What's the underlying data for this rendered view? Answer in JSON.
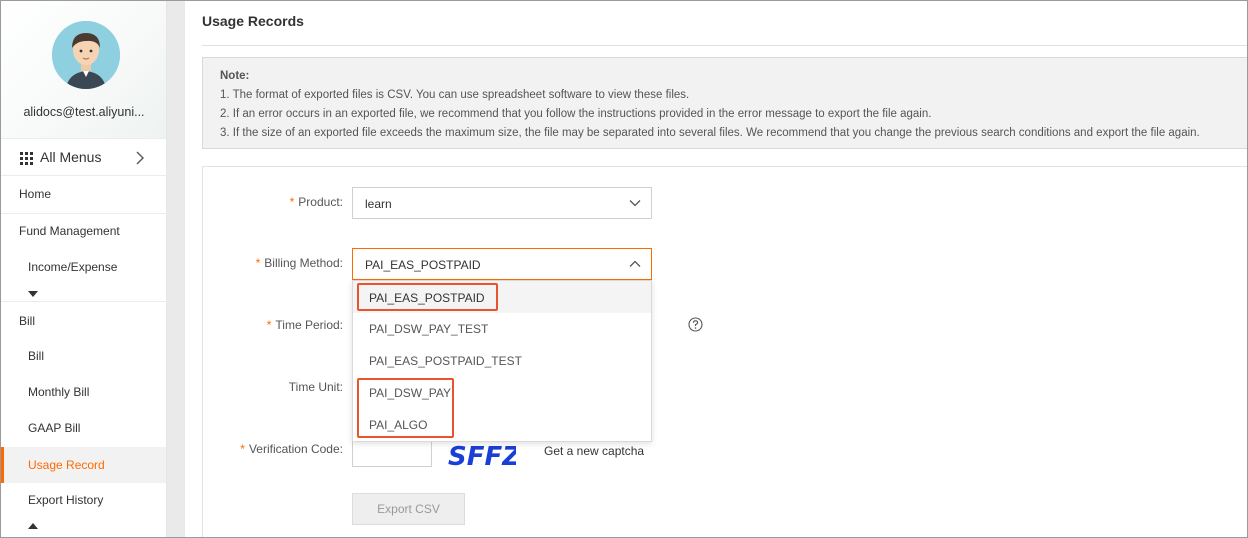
{
  "user": {
    "email": "alidocs@test.aliyuni..."
  },
  "menu": {
    "all_menus_label": "All Menus"
  },
  "nav": {
    "home": "Home",
    "fund_management": "Fund Management",
    "income_expense": "Income/Expense",
    "bill_group": "Bill",
    "bill": "Bill",
    "monthly_bill": "Monthly Bill",
    "gaap_bill": "GAAP Bill",
    "usage_record": "Usage Record",
    "export_history": "Export History"
  },
  "page": {
    "title": "Usage Records"
  },
  "note": {
    "title": "Note:",
    "lines": [
      "1. The format of exported files is CSV. You can use spreadsheet software to view these files.",
      "2. If an error occurs in an exported file, we recommend that you follow the instructions provided in the error message to export the file again.",
      "3. If the size of an exported file exceeds the maximum size, the file may be separated into several files. We recommend that you change the previous search conditions and export the file again."
    ]
  },
  "form": {
    "required_mark": "*",
    "product_label": "Product:",
    "product_value": "learn",
    "billing_method_label": "Billing Method:",
    "billing_method_value": "PAI_EAS_POSTPAID",
    "time_period_label": "Time Period:",
    "time_unit_label": "Time Unit:",
    "verification_code_label": "Verification Code:",
    "captcha_text": "SFFZ",
    "get_new_captcha": "Get a new captcha",
    "export_button": "Export CSV"
  },
  "billing_options": [
    "PAI_EAS_POSTPAID",
    "PAI_DSW_PAY_TEST",
    "PAI_EAS_POSTPAID_TEST",
    "PAI_DSW_PAY",
    "PAI_ALGO"
  ],
  "icons": {
    "grid": "grid-icon",
    "chevron_right": "chevron-right-icon",
    "chevron_down": "chevron-down-icon",
    "chevron_up": "chevron-up-icon",
    "help": "help-icon"
  },
  "colors": {
    "accent": "#ff6a00",
    "highlight_box": "#e8542e",
    "note_bg": "#f2f2f2"
  }
}
